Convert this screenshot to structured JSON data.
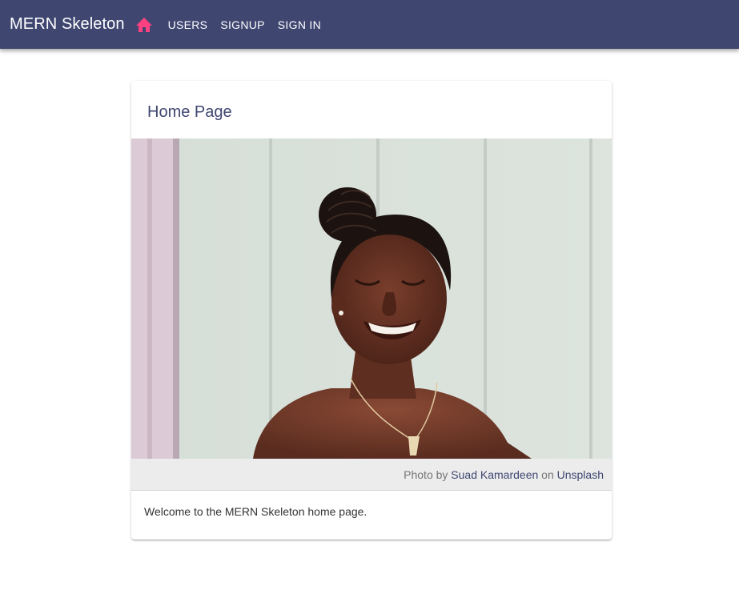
{
  "appbar": {
    "title": "MERN Skeleton",
    "home_icon": "home-icon",
    "home_icon_color": "#ff4081",
    "background": "#3f4771",
    "nav": [
      {
        "label": "Users"
      },
      {
        "label": "Signup"
      },
      {
        "label": "Sign In"
      }
    ]
  },
  "card": {
    "title": "Home Page",
    "caption": {
      "prefix": "Photo by",
      "author": "Suad Kamardeen",
      "middle": "on",
      "source": "Unsplash"
    },
    "body": "Welcome to the MERN Skeleton home page."
  }
}
